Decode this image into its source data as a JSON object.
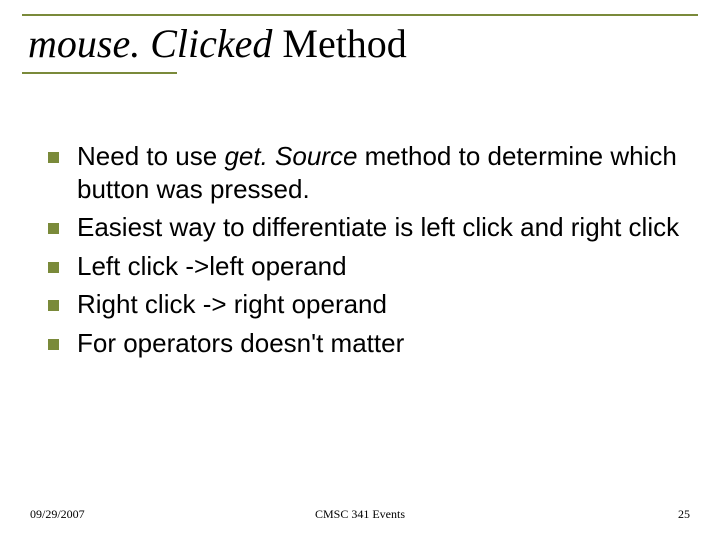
{
  "title": {
    "italic_part": "mouse. Clicked",
    "rest": " Method"
  },
  "bullets": [
    {
      "pre": "Need to use ",
      "italic": "get. Source",
      "post": " method to determine which button was pressed."
    },
    {
      "pre": "Easiest way to differentiate is left click and right click",
      "italic": "",
      "post": ""
    },
    {
      "pre": "Left click ->left operand",
      "italic": "",
      "post": ""
    },
    {
      "pre": "Right click -> right operand",
      "italic": "",
      "post": ""
    },
    {
      "pre": "For operators doesn't matter",
      "italic": "",
      "post": ""
    }
  ],
  "footer": {
    "date": "09/29/2007",
    "center": "CMSC 341 Events",
    "page": "25"
  }
}
